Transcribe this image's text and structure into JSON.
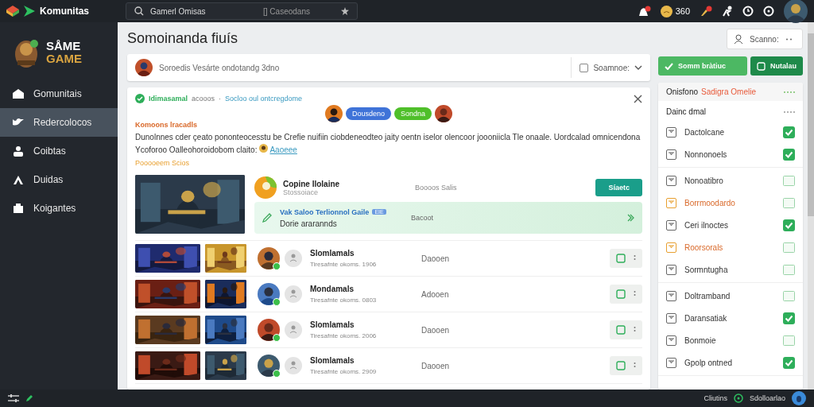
{
  "topbar": {
    "brand": "Komunitas",
    "search": {
      "value": "Gamerl Omisas",
      "hint": "[] Caseodans"
    },
    "coins": "360"
  },
  "sidebar": {
    "logo": [
      "SÅME",
      "GAME"
    ],
    "items": [
      {
        "label": "Gomunitais",
        "selected": false
      },
      {
        "label": "Redercolocos",
        "selected": true
      },
      {
        "label": "Coibtas",
        "selected": false
      },
      {
        "label": "Duidas",
        "selected": false
      },
      {
        "label": "Koigantes",
        "selected": false
      }
    ]
  },
  "page": {
    "title": "Somoinanda fiuís",
    "scope": "Scanno:"
  },
  "composer": {
    "text": "Soroedis Vesárte ondotandg 3dno",
    "filter": "Soamnoe:"
  },
  "actions": [
    {
      "label": "Somm bràtiuc",
      "kind": "primary"
    },
    {
      "label": "Nutalau",
      "kind": "secondary"
    }
  ],
  "post": {
    "author": "Idimasamal",
    "meta": "acooos",
    "dot": "·",
    "group": "Socloo oul ontcregdome",
    "pills": [
      {
        "label": "Dousdeno",
        "color": "#3f73d8"
      },
      {
        "label": "Sondna",
        "color": "#4fbf2a"
      }
    ],
    "heading": "Komoons lracadls",
    "body": "Dunolnnes cder çeato pononteocesstu be Crefie nuifiin ciobdeneodteo jaity oentn iselor olencoor joooniicla Tle onaale. Uordcalad omnicendona Ycoforoo Oalleohoroidobom claito:",
    "link": "Aaoeee",
    "footnote": "Pooooeem Scios",
    "featured": {
      "name": "Copine Ilolaine",
      "sub": "Stossoiace",
      "info": "Boooos Salis",
      "button": "Síaetc",
      "promo_title": "Vak Saloo Terlionnol Gaile",
      "promo_tag": "EIE",
      "promo_sub": "Dorie ararannds",
      "promo_value": "Bacoot"
    },
    "rows": [
      {
        "name": "Slomlamals",
        "sub": "Tiresafnte okoms. 1906",
        "status": "Daooen"
      },
      {
        "name": "Mondamals",
        "sub": "Tiresafnte okoms. 0803",
        "status": "Adooen"
      },
      {
        "name": "Slomlamals",
        "sub": "Tiresafnte okoms. 2006",
        "status": "Daooen"
      },
      {
        "name": "Slomlamals",
        "sub": "Tiresafnte okoms. 2909",
        "status": "Daooen"
      }
    ]
  },
  "panel": {
    "title": "Onisfono",
    "title_accent": "Sadigra Omelie",
    "subtitle": "Dainc dmal",
    "groups": [
      [
        {
          "label": "Dactolcane",
          "checked": true,
          "accent": false
        },
        {
          "label": "Nonnonoels",
          "checked": true,
          "accent": false
        }
      ],
      [
        {
          "label": "Nonoatibro",
          "checked": false,
          "accent": false
        },
        {
          "label": "Borrmoodardo",
          "checked": false,
          "accent": true
        },
        {
          "label": "Ceri ilnoctes",
          "checked": true,
          "accent": false
        },
        {
          "label": "Roorsorals",
          "checked": false,
          "accent": true
        },
        {
          "label": "Sormntugha",
          "checked": false,
          "accent": false
        }
      ],
      [
        {
          "label": "Doltramband",
          "checked": false,
          "accent": false
        },
        {
          "label": "Daransatiak",
          "checked": true,
          "accent": false
        },
        {
          "label": "Bonmoie",
          "checked": false,
          "accent": false
        },
        {
          "label": "Gpolp ontned",
          "checked": true,
          "accent": false
        }
      ]
    ]
  },
  "statusbar": {
    "left": "Cliutins",
    "right": "Sdolloarlao"
  }
}
